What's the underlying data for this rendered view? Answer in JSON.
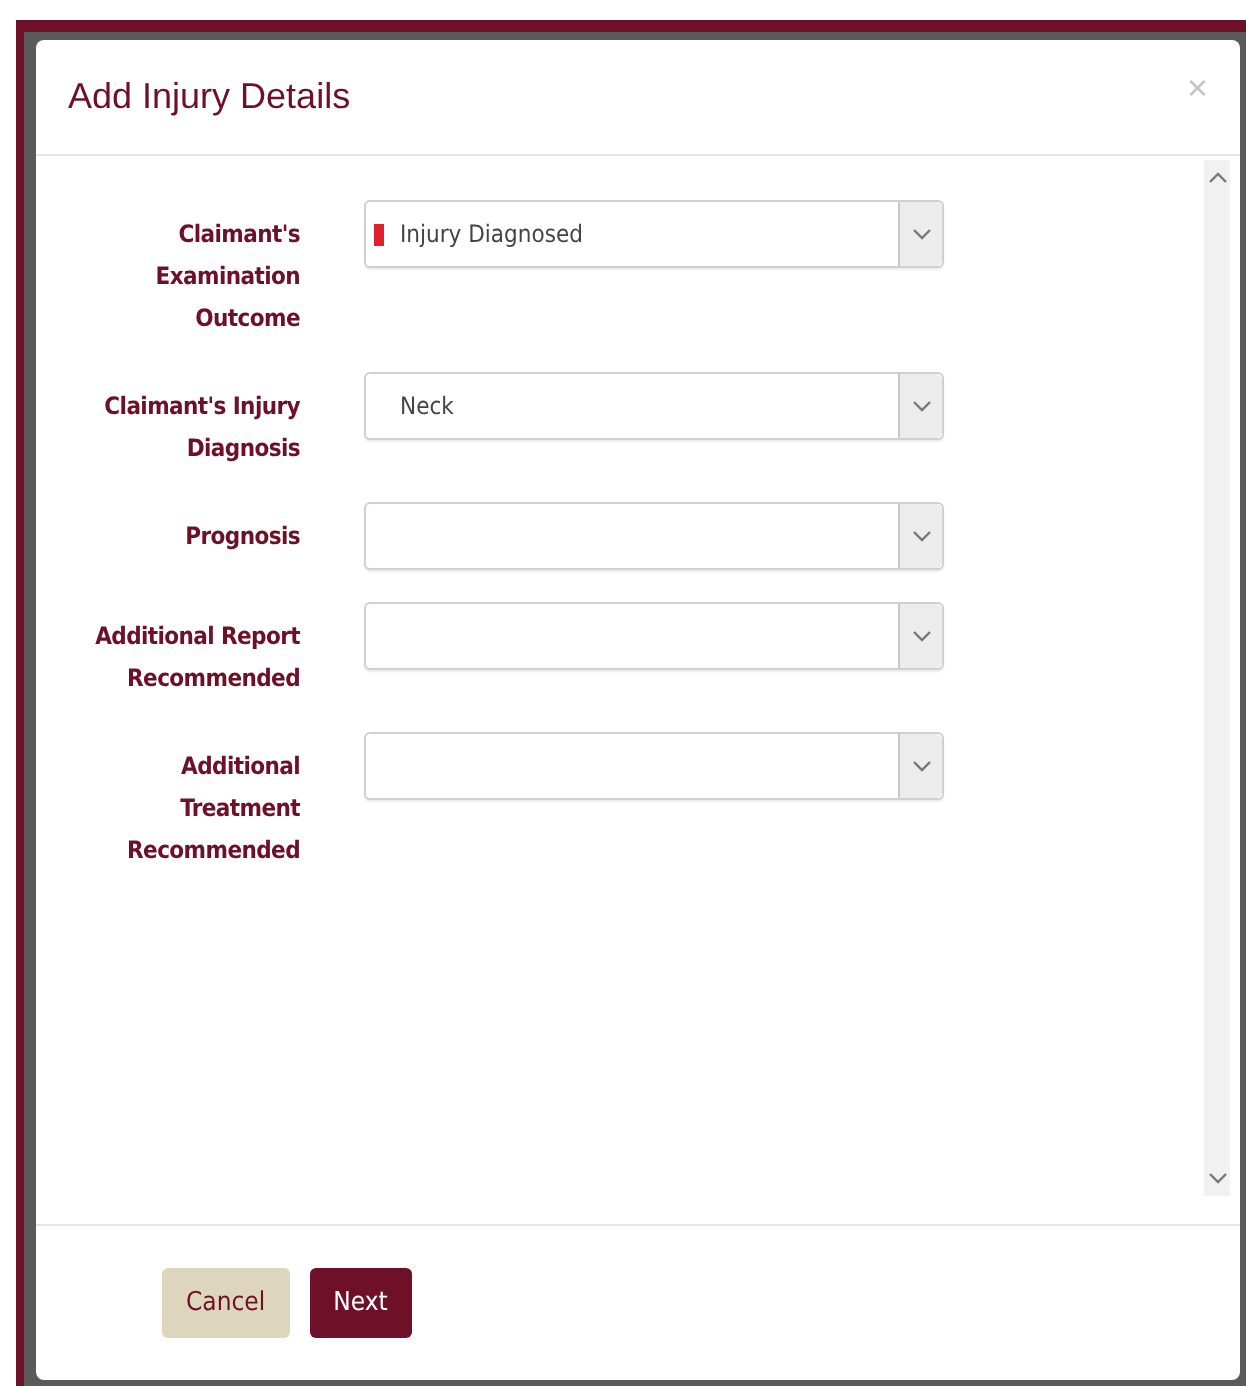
{
  "dialog": {
    "title": "Add Injury Details",
    "close": "×"
  },
  "fields": [
    {
      "label": "Claimant's Examination Outcome",
      "value": "Injury Diagnosed",
      "color": "#e0202e"
    },
    {
      "label": "Claimant's Injury Diagnosis",
      "value": "Neck"
    },
    {
      "label": "Prognosis"
    },
    {
      "label": "Additional Report Recommended"
    },
    {
      "label": "Additional Treatment Recommended"
    }
  ],
  "buttons": [
    {
      "label": "Cancel",
      "kind": "secondary"
    },
    {
      "label": "Next",
      "kind": "primary"
    }
  ]
}
